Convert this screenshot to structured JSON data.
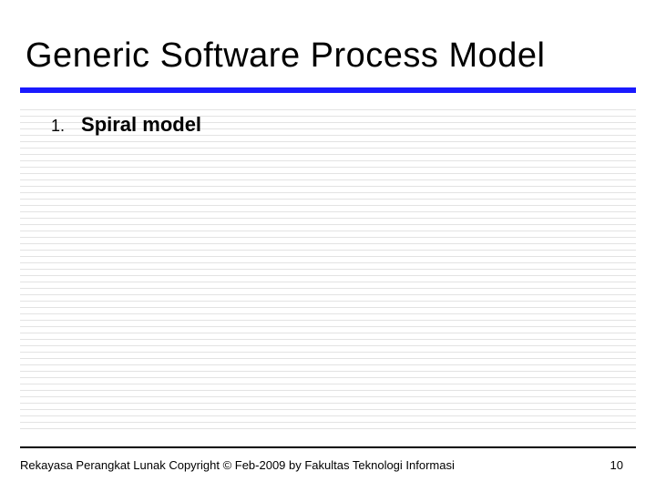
{
  "slide": {
    "title": "Generic Software Process Model",
    "list": {
      "number": "1.",
      "text": "Spiral model"
    },
    "footer": "Rekayasa Perangkat Lunak Copyright © Feb-2009 by Fakultas Teknologi Informasi",
    "page_number": "10"
  }
}
